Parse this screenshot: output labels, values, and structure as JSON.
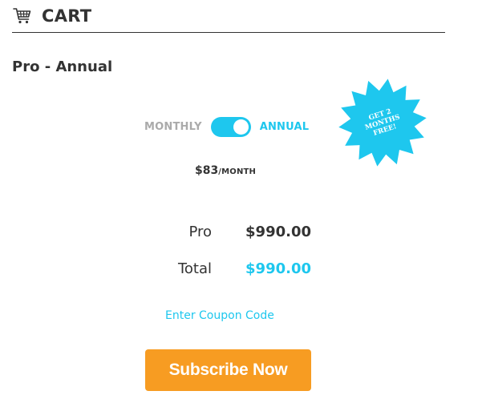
{
  "header": {
    "title": "CART",
    "icon": "shopping-cart-icon"
  },
  "product": {
    "name": "Pro - Annual"
  },
  "billing": {
    "monthly_label": "MONTHLY",
    "annual_label": "ANNUAL",
    "selected": "annual"
  },
  "promo": {
    "line1": "GET 2",
    "line2": "MONTHS",
    "line3": "FREE!"
  },
  "price": {
    "amount": "$83",
    "unit": "/MONTH"
  },
  "summary": {
    "item_label": "Pro",
    "item_value": "$990.00",
    "total_label": "Total",
    "total_value": "$990.00"
  },
  "coupon": {
    "label": "Enter Coupon Code"
  },
  "subscribe": {
    "label": "Subscribe Now"
  },
  "colors": {
    "accent": "#1ec7ee",
    "button": "#f79c22",
    "text": "#333333",
    "muted": "#aaaaaa"
  }
}
